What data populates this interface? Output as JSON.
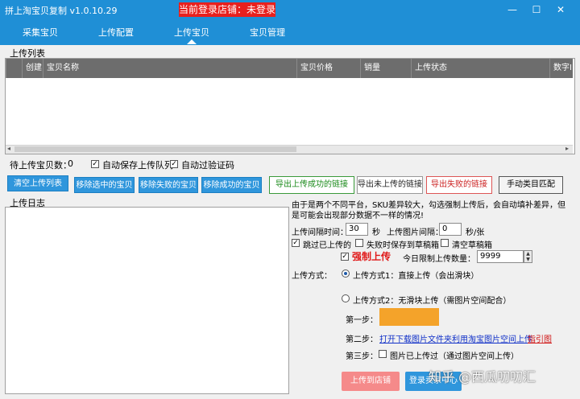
{
  "titlebar": {
    "app_title": "拼上淘宝贝复制 v1.0.10.29",
    "login_status": "当前登录店铺：未登录"
  },
  "window_controls": {
    "minimize": "—",
    "maximize": "☐",
    "close": "✕"
  },
  "nav": {
    "tabs": [
      "采集宝贝",
      "上传配置",
      "上传宝贝",
      "宝贝管理"
    ],
    "active": "上传宝贝"
  },
  "upload_list": {
    "section_label": "上传列表",
    "columns": [
      "创建",
      "宝贝名称",
      "宝贝价格",
      "销量",
      "上传状态",
      "数字ID"
    ]
  },
  "controls": {
    "pending_label": "待上传宝贝数：",
    "pending_count": "0",
    "auto_save_queue": "自动保存上传队列",
    "auto_skip_captcha": "自动过验证码"
  },
  "buttons": {
    "clear_list": "清空上传列表",
    "remove_selected": "移除选中的宝贝",
    "remove_failed": "移除失败的宝贝",
    "remove_success": "移除成功的宝贝",
    "export_success": "导出上传成功的链接",
    "export_unuploaded": "导出未上传的链接",
    "export_failed": "导出失败的链接",
    "manual_category": "手动类目匹配"
  },
  "log": {
    "section_label": "上传日志"
  },
  "settings": {
    "notice": "由于是两个不同平台，SKU差异较大，勾选强制上传后，会自动填补差异，但是可能会出现部分数据不一样的情况!",
    "interval_label": "上传间隔时间：",
    "interval_value": "30",
    "interval_unit": "秒",
    "img_interval_label": "上传图片间隔：",
    "img_interval_value": "0",
    "img_interval_unit": "秒/张",
    "skip_uploaded": "跳过已上传的",
    "save_draft_on_fail": "失败时保存到草稿箱",
    "clear_drafts": "清空草稿箱",
    "force_upload": "强制上传",
    "daily_limit_label": "今日限制上传数量：",
    "daily_limit_value": "9999",
    "method_label": "上传方式：",
    "method1": "上传方式1：直接上传（会出滑块）",
    "method2": "上传方式2：无滑块上传（需图片空间配合）",
    "step1_label": "第一步：",
    "step2_label": "第二步：",
    "step2_link": "打开下载图片文件夹利用淘宝图片空间上传",
    "step2_guide": "指引图",
    "step3_label": "第三步：",
    "step3_text": "图片已上传过（通过图片空间上传）"
  },
  "bottom": {
    "upload_to_store": "上传到店铺",
    "login_seller": "登录卖家中心"
  },
  "watermark": "知乎 @西瓜叨叨汇"
}
